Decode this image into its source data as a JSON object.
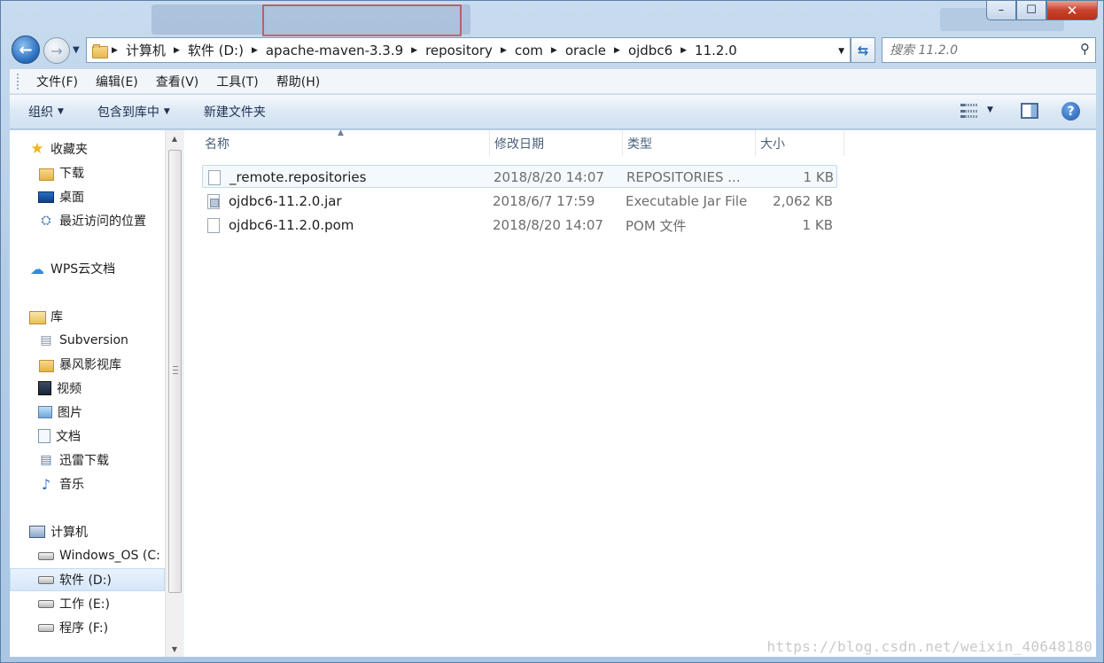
{
  "window": {
    "controls": {
      "minimize": "–",
      "maximize": "☐",
      "close": "✕"
    }
  },
  "address_bar": {
    "crumbs": [
      "计算机",
      "软件 (D:)",
      "apache-maven-3.3.9",
      "repository",
      "com",
      "oracle",
      "ojdbc6",
      "11.2.0"
    ],
    "search_placeholder": "搜索 11.2.0"
  },
  "menu": [
    "文件(F)",
    "编辑(E)",
    "查看(V)",
    "工具(T)",
    "帮助(H)"
  ],
  "toolbar": {
    "organize": "组织",
    "include_in_library": "包含到库中",
    "new_folder": "新建文件夹"
  },
  "nav_pane": {
    "favorites": {
      "label": "收藏夹",
      "items": [
        "下载",
        "桌面",
        "最近访问的位置"
      ]
    },
    "wps": "WPS云文档",
    "libraries": {
      "label": "库",
      "items": [
        "Subversion",
        "暴风影视库",
        "视频",
        "图片",
        "文档",
        "迅雷下载",
        "音乐"
      ]
    },
    "computer": {
      "label": "计算机",
      "items": [
        "Windows_OS (C:",
        "软件 (D:)",
        "工作 (E:)",
        "程序 (F:)"
      ],
      "selected": "软件 (D:)"
    }
  },
  "columns": {
    "name": "名称",
    "modified": "修改日期",
    "type": "类型",
    "size": "大小"
  },
  "files": [
    {
      "name": "_remote.repositories",
      "modified": "2018/8/20 14:07",
      "type": "REPOSITORIES ...",
      "size": "1 KB"
    },
    {
      "name": "ojdbc6-11.2.0.jar",
      "modified": "2018/6/7 17:59",
      "type": "Executable Jar File",
      "size": "2,062 KB"
    },
    {
      "name": "ojdbc6-11.2.0.pom",
      "modified": "2018/8/20 14:07",
      "type": "POM 文件",
      "size": "1 KB"
    }
  ],
  "watermark": "https://blog.csdn.net/weixin_40648180",
  "colors": {
    "accent": "#2a6fc0",
    "selection": "#d5e7f9",
    "close_button": "#c8432b"
  }
}
